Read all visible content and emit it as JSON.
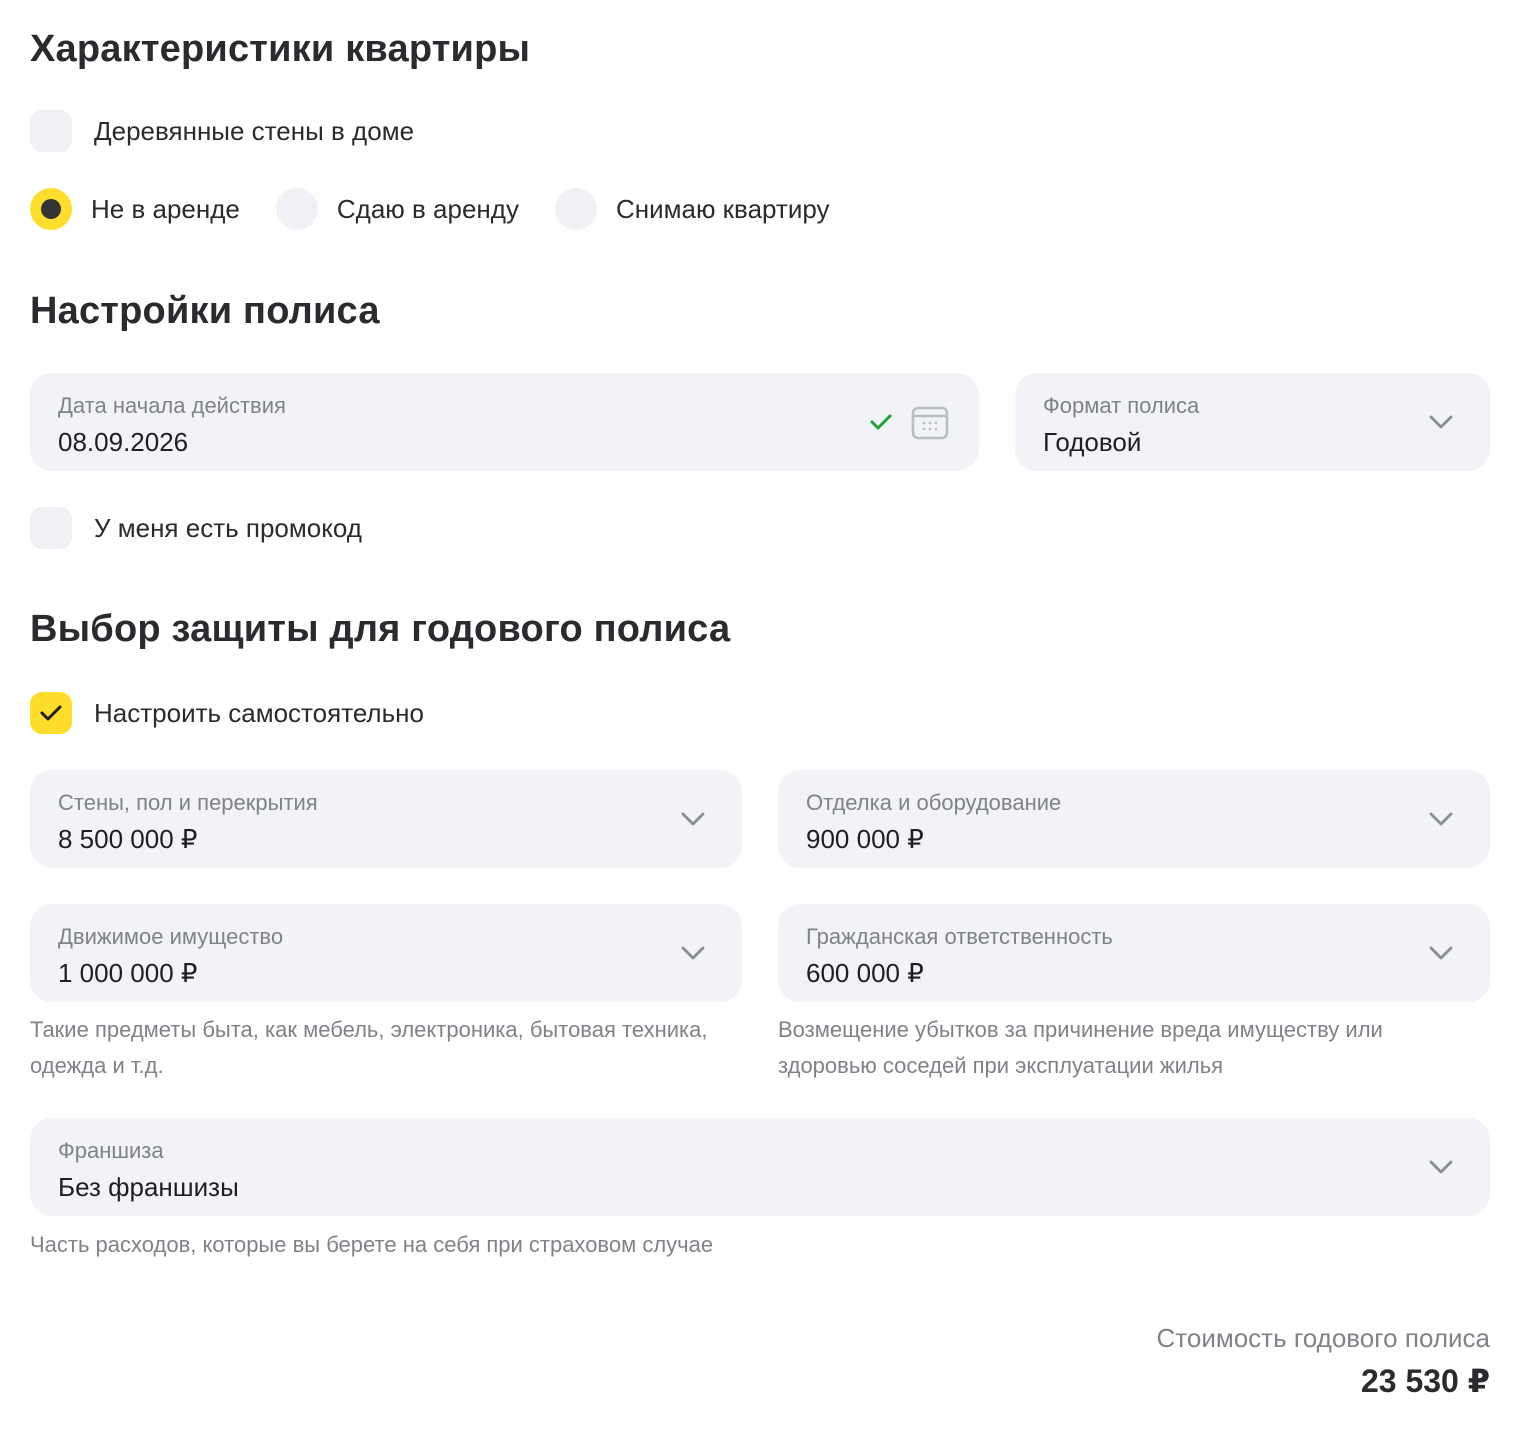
{
  "apartment": {
    "title": "Характеристики квартиры",
    "wooden_walls": {
      "label": "Деревянные стены в доме",
      "checked": false
    },
    "rent_options": [
      {
        "label": "Не в аренде",
        "selected": true
      },
      {
        "label": "Сдаю в аренду",
        "selected": false
      },
      {
        "label": "Снимаю квартиру",
        "selected": false
      }
    ]
  },
  "policy": {
    "title": "Настройки полиса",
    "start_date": {
      "label": "Дата начала действия",
      "value": "08.09.2026"
    },
    "format": {
      "label": "Формат полиса",
      "value": "Годовой"
    },
    "promo": {
      "label": "У меня есть промокод",
      "checked": false
    }
  },
  "protection": {
    "title": "Выбор защиты для годового полиса",
    "custom": {
      "label": "Настроить самостоятельно",
      "checked": true
    },
    "walls": {
      "label": "Стены, пол и перекрытия",
      "value": "8 500 000 ₽"
    },
    "finish": {
      "label": "Отделка и оборудование",
      "value": "900 000 ₽"
    },
    "movable": {
      "label": "Движимое имущество",
      "value": "1 000 000 ₽",
      "hint": "Такие предметы быта, как мебель, электроника, бытовая техника, одежда и т.д."
    },
    "liability": {
      "label": "Гражданская ответственность",
      "value": "600 000 ₽",
      "hint": "Возмещение убытков за причинение вреда имуществу или здоровью соседей при эксплуатации жилья"
    },
    "deductible": {
      "label": "Франшиза",
      "value": "Без франшизы",
      "hint": "Часть расходов, которые вы берете на себя при страховом случае"
    }
  },
  "total": {
    "label": "Стоимость годового полиса",
    "value": "23 530 ₽"
  },
  "colors": {
    "accent": "#ffdd2d",
    "field_bg": "#f2f3f7",
    "ok": "#21a038"
  }
}
